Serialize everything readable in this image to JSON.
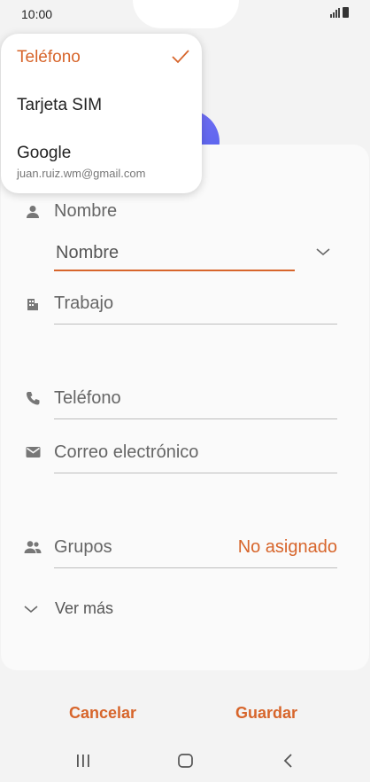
{
  "status_bar": {
    "time": "10:00"
  },
  "popup": {
    "items": [
      {
        "label": "Teléfono",
        "selected": true
      },
      {
        "label": "Tarjeta SIM"
      },
      {
        "label": "Google",
        "sublabel": "juan.ruiz.wm@gmail.com"
      }
    ]
  },
  "form": {
    "name_section_label": "Nombre",
    "name_input_placeholder": "Nombre",
    "work_placeholder": "Trabajo",
    "phone_placeholder": "Teléfono",
    "email_placeholder": "Correo electrónico",
    "groups_label": "Grupos",
    "groups_value": "No asignado",
    "more_label": "Ver más"
  },
  "buttons": {
    "cancel": "Cancelar",
    "save": "Guardar"
  },
  "colors": {
    "accent": "#d7652b",
    "avatar": "#6b6cf2"
  }
}
